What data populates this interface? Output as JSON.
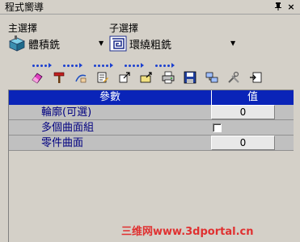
{
  "window": {
    "title": "程式嚮導",
    "pin_glyph": "ㅂ",
    "close_glyph": "×"
  },
  "selectors": {
    "main_label": "主選擇",
    "main_value": "體積銑",
    "sub_label": "子選擇",
    "sub_value": "環繞粗銑",
    "dropdown_glyph": "▼"
  },
  "toolbar": {
    "icons": [
      "eraser-icon",
      "hammer-icon",
      "hand-curve-icon",
      "document-pencil-icon",
      "export-icon",
      "folder-export-icon",
      "print-icon",
      "save-icon",
      "network-icon",
      "tools-icon",
      "import-icon"
    ]
  },
  "grid": {
    "header_param": "參數",
    "header_value": "值",
    "rows": [
      {
        "label": "輪廓(可選)",
        "value": "0"
      },
      {
        "label": "多個曲面組",
        "checked": false
      },
      {
        "label": "零件曲面",
        "value": "0"
      }
    ]
  },
  "watermark": "三维网www.3dportal.cn",
  "colors": {
    "header_bg": "#0a24b8",
    "row_label": "#000080",
    "panel_bg": "#d4d0c8"
  }
}
